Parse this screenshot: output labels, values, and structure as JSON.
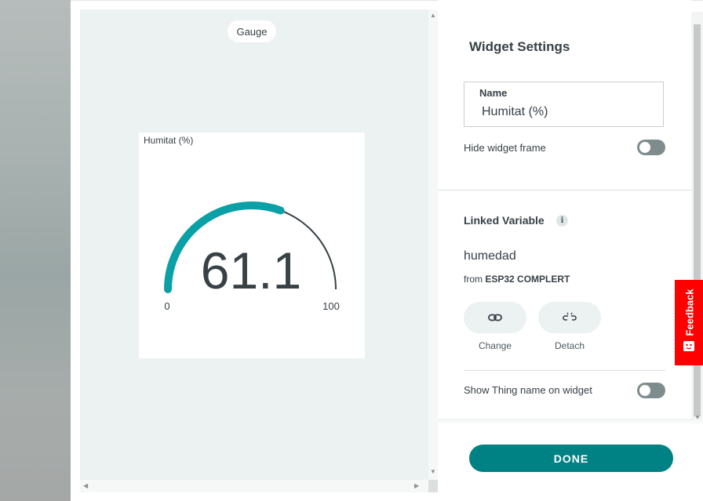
{
  "preview": {
    "widget_type": "Gauge",
    "widget": {
      "title": "Humitat (%)",
      "value": "61.1",
      "min_label": "0",
      "max_label": "100",
      "value_fraction": 0.611
    }
  },
  "settings": {
    "title": "Widget Settings",
    "name_label": "Name",
    "name_value": "Humitat (%)",
    "hide_frame_label": "Hide widget frame",
    "hide_frame_on": false,
    "linked_variable_title": "Linked Variable",
    "info_glyph": "i",
    "variable_name": "humedad",
    "from_prefix": "from",
    "device_name": "ESP32 COMPLERT",
    "change_label": "Change",
    "detach_label": "Detach",
    "show_thing_label": "Show Thing name on widget",
    "show_thing_on": false
  },
  "done_label": "DONE",
  "feedback_label": "Feedback",
  "icons": {
    "change": "link-icon",
    "detach": "unlink-icon",
    "info": "info-icon",
    "feedback": "feedback-face-icon"
  },
  "colors": {
    "accent": "#008184",
    "gauge_fill": "#0aa0a5",
    "gauge_track": "#374146",
    "feedback": "#ff0000",
    "preview_bg": "#ecf1f1"
  }
}
